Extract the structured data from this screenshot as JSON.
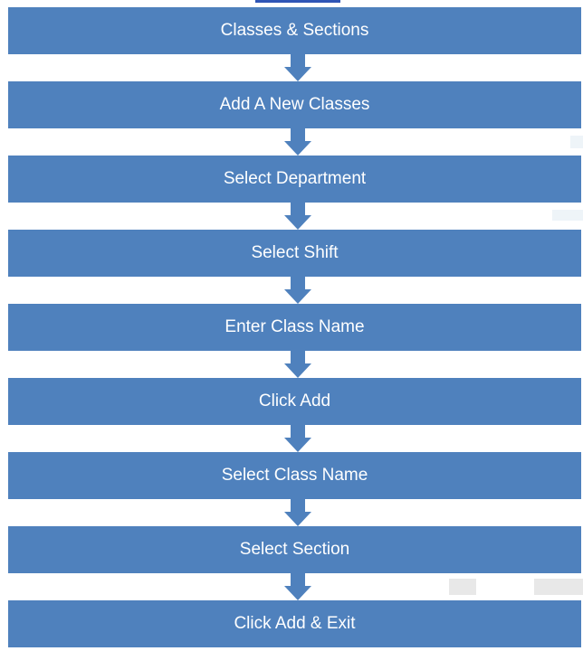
{
  "flowchart": {
    "steps": [
      "Classes & Sections",
      "Add A New Classes",
      "Select Department",
      "Select Shift",
      "Enter Class Name",
      "Click Add",
      "Select Class Name",
      "Select Section",
      "Click Add & Exit"
    ]
  },
  "colors": {
    "box": "#4f81bd",
    "arrow": "#4f81bd",
    "text": "#ffffff"
  }
}
